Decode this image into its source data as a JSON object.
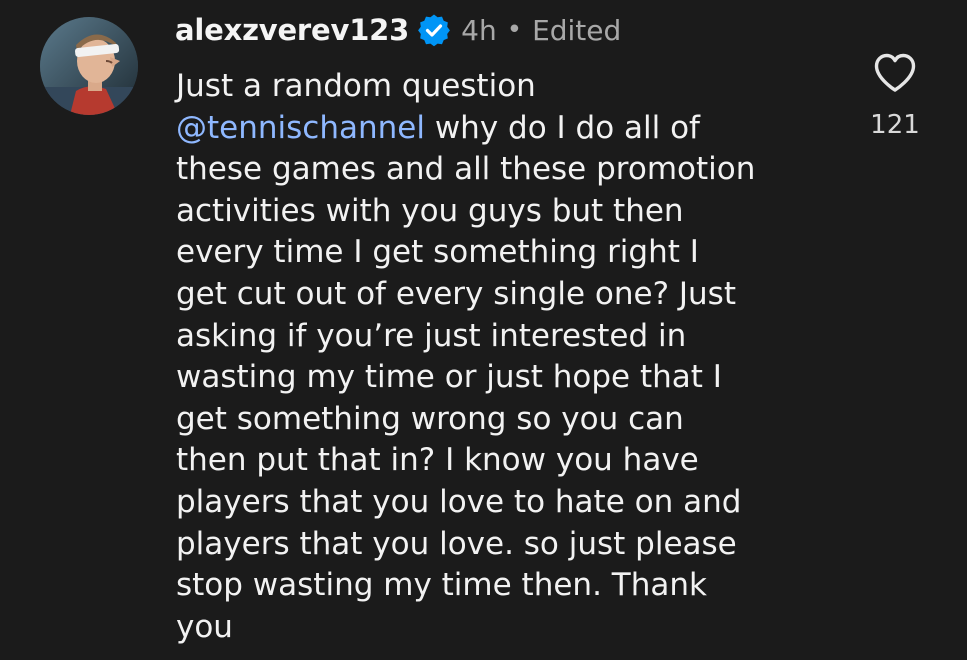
{
  "comment": {
    "username": "alexzverev123",
    "verified": true,
    "time": "4h",
    "separator": "•",
    "edited": "Edited",
    "icons": {
      "avatar": "profile-avatar",
      "verified": "verified-badge-icon",
      "like": "heart-icon",
      "mention": "threads-icon"
    },
    "text_lines": {
      "l1": "Just a random question",
      "l2_mention": "@tennischannel",
      "l2_rest": " why do I do all of",
      "l3": "these games and all these promotion",
      "l4": "activities with you guys but then",
      "l5": "every time I get something right I",
      "l6": "get cut out of every single one? Just",
      "l7": "asking if you’re just interested in",
      "l8": "wasting my time or just hope that I",
      "l9": "get something wrong so you can",
      "l10": "then put that in? I know you have",
      "l11": "players that you love to hate on and",
      "l12": "players that you love. so just please",
      "l13": "stop wasting my time then. Thank",
      "l14": "you"
    },
    "likes": "121"
  },
  "colors": {
    "background": "#1b1b1b",
    "text": "#f2f2f2",
    "muted": "#a8a8a8",
    "mention": "#8fb8ff",
    "verified_badge": "#0095f6"
  }
}
